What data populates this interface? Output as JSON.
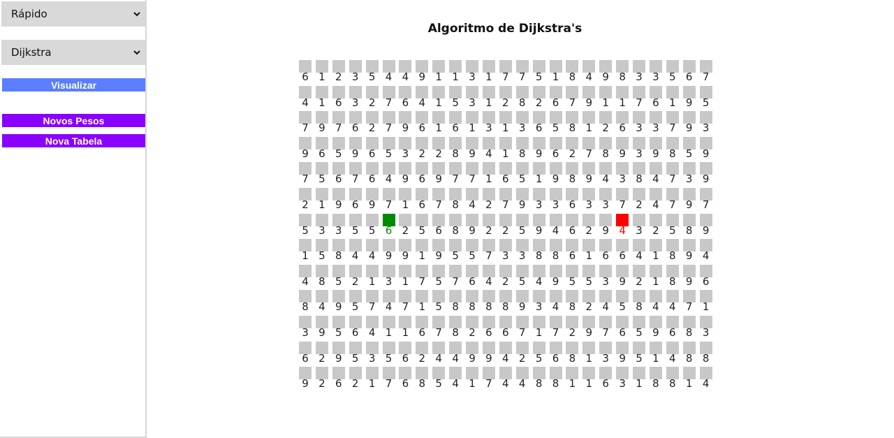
{
  "sidebar": {
    "speed_select": {
      "value": "Rápido",
      "icon": "chevron-down-icon"
    },
    "algorithm_select": {
      "value": "Dijkstra",
      "icon": "chevron-down-icon"
    },
    "visualize_label": "Visualizar",
    "new_weights_label": "Novos Pesos",
    "new_table_label": "Nova Tabela"
  },
  "colors": {
    "visualize_button": "#5b7dff",
    "purple_buttons": "#8a00ff",
    "cell": "#c8c8c8",
    "start_node": "#008a00",
    "end_node": "#ff0000"
  },
  "main": {
    "title": "Algoritmo de Dijkstra's"
  },
  "grid": {
    "start": {
      "row": 6,
      "col": 5
    },
    "end": {
      "row": 6,
      "col": 19
    },
    "rows": [
      "6123544911317751849833567",
      "4163276415312826791176195",
      "7976279616131365812633793",
      "9659653228941896278939859",
      "7567649697716519894384739",
      "2196971678427933633724797",
      "5335562568922594629432589",
      "1584499195573388616641894",
      "4852131757642549553921896",
      "8495747158888934824584471",
      "3956411678266717297659683",
      "6295356244994256813951488",
      "9262176854174488116318814"
    ]
  }
}
